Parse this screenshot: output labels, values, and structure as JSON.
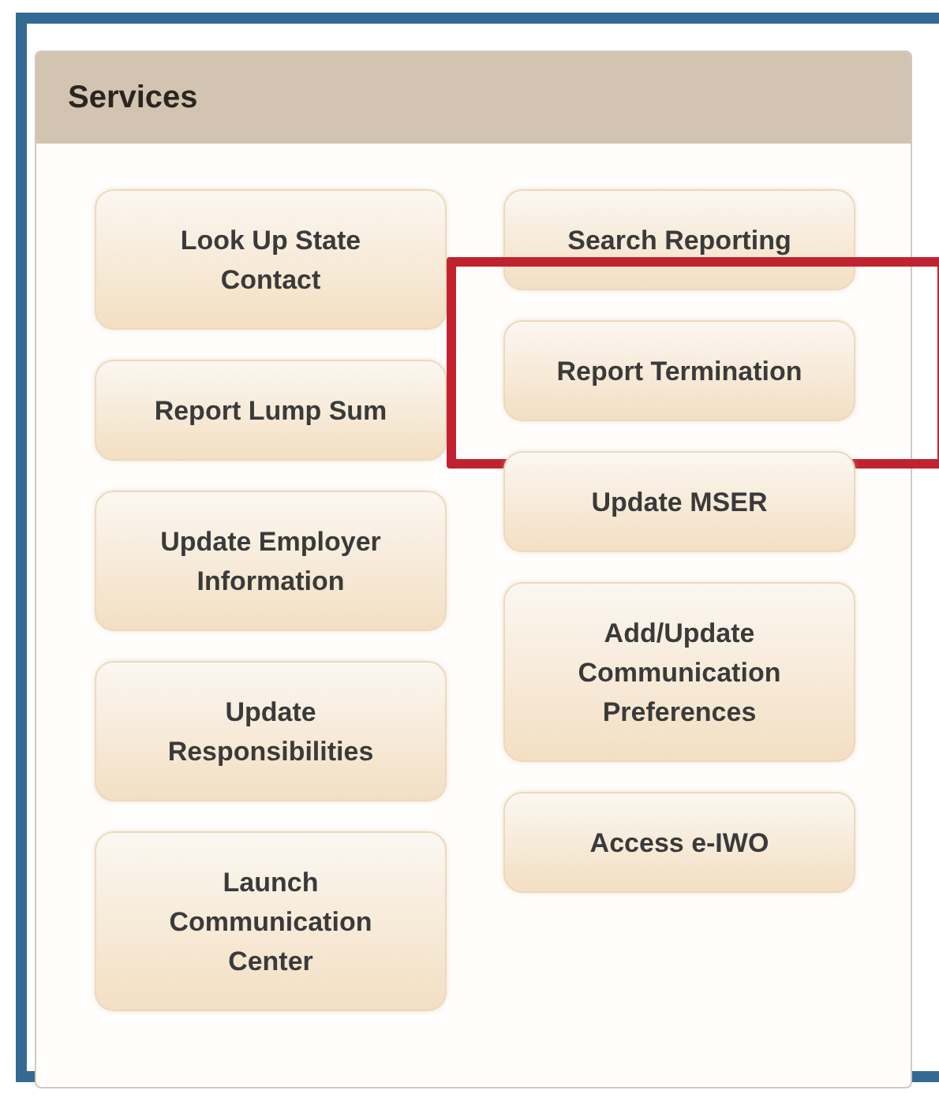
{
  "panel": {
    "title": "Services"
  },
  "columns": [
    [
      {
        "label": "Look Up State\nContact",
        "highlighted": false
      },
      {
        "label": "Report Lump Sum",
        "highlighted": false
      },
      {
        "label": "Update Employer\nInformation",
        "highlighted": false
      },
      {
        "label": "Update\nResponsibilities",
        "highlighted": false
      },
      {
        "label": "Launch\nCommunication\nCenter",
        "highlighted": false
      }
    ],
    [
      {
        "label": "Search Reporting",
        "highlighted": false
      },
      {
        "label": "Report Termination",
        "highlighted": true
      },
      {
        "label": "Update MSER",
        "highlighted": false
      },
      {
        "label": "Add/Update\nCommunication\nPreferences",
        "highlighted": false
      },
      {
        "label": "Access e-IWO",
        "highlighted": false
      }
    ]
  ]
}
